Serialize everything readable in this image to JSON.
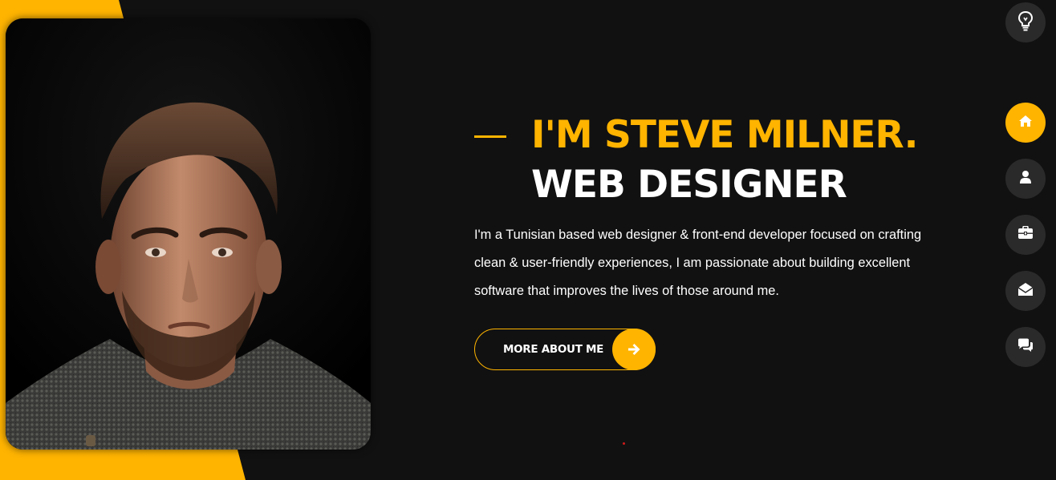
{
  "theme": {
    "accent": "#ffb400",
    "background": "#111111",
    "button_bg": "#2b2a2a",
    "text": "#ffffff"
  },
  "hero": {
    "title_line_1": "I'M STEVE MILNER.",
    "title_line_2": "WEB DESIGNER",
    "bio": "I'm a Tunisian based web designer & front-end developer focused on crafting clean & user-friendly experiences, I am passionate about building excellent software that improves the lives of those around me.",
    "cta_label": "MORE ABOUT ME",
    "cta_icon": "arrow-right-icon"
  },
  "theme_toggle": {
    "icon": "lightbulb-icon"
  },
  "side_nav": {
    "active_index": 0,
    "items": [
      {
        "icon": "home-icon"
      },
      {
        "icon": "user-icon"
      },
      {
        "icon": "briefcase-icon"
      },
      {
        "icon": "envelope-open-icon"
      },
      {
        "icon": "comments-icon"
      }
    ]
  },
  "portrait": {
    "icon": "profile-photo"
  }
}
